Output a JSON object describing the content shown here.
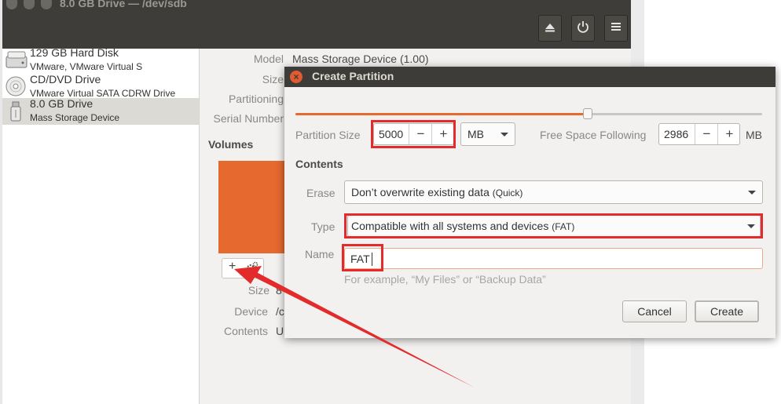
{
  "window": {
    "title": "8.0 GB Drive — /dev/sdb"
  },
  "header_buttons": {
    "eject": "⏏",
    "power": "⏻",
    "menu": "≡"
  },
  "sidebar": {
    "items": [
      {
        "name": "129 GB Hard Disk",
        "detail": "VMware, VMware Virtual S",
        "icon": "hard-disk-icon"
      },
      {
        "name": "CD/DVD Drive",
        "detail": "VMware Virtual SATA CDRW Drive",
        "icon": "optical-drive-icon"
      },
      {
        "name": "8.0 GB Drive",
        "detail": "Mass Storage Device",
        "icon": "usb-drive-icon"
      }
    ]
  },
  "drive_props": {
    "model_label": "Model",
    "model_value": "Mass Storage Device (1.00)",
    "size_label": "Size",
    "partitioning_label": "Partitioning",
    "serial_label": "Serial Number"
  },
  "volumes": {
    "header": "Volumes",
    "add_glyph": "+",
    "size_label": "Size",
    "size_value": "8",
    "device_label": "Device",
    "device_value": "/c",
    "contents_label": "Contents",
    "contents_value": "U"
  },
  "dialog": {
    "title": "Create Partition",
    "close_glyph": "×",
    "slider_fraction": 0.627,
    "partition_size_label": "Partition Size",
    "partition_size_value": "5000",
    "minus": "−",
    "plus": "+",
    "unit_value": "MB",
    "free_space_label": "Free Space Following",
    "free_space_value": "2986",
    "free_space_unit": "MB",
    "contents_header": "Contents",
    "erase_label": "Erase",
    "erase_value": "Don’t overwrite existing data",
    "erase_note": "(Quick)",
    "type_label": "Type",
    "type_value": "Compatible with all systems and devices",
    "type_note": "(FAT)",
    "name_label": "Name",
    "name_value": "FAT",
    "name_hint": "For example, “My Files” or “Backup Data”",
    "cancel_label": "Cancel",
    "create_label": "Create"
  },
  "colors": {
    "accent": "#e6692f",
    "annotation": "#e32b2b",
    "titlebar": "#3e3d39"
  }
}
